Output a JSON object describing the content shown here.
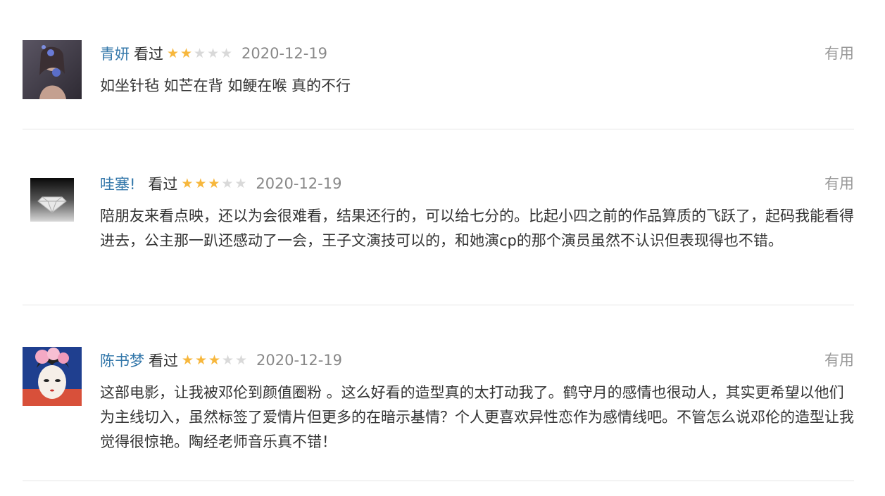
{
  "comments": [
    {
      "user": "青妍",
      "status": "看过",
      "rating": 2,
      "date": "2020-12-19",
      "useful": "有用",
      "text": "如坐针毡 如芒在背 如鲠在喉 真的不行"
    },
    {
      "user": "哇塞!",
      "status": "看过",
      "rating": 3,
      "date": "2020-12-19",
      "useful": "有用",
      "text": "陪朋友来看点映，还以为会很难看，结果还行的，可以给七分的。比起小四之前的作品算质的飞跃了，起码我能看得进去，公主那一趴还感动了一会，王子文演技可以的，和她演cp的那个演员虽然不认识但表现得也不错。"
    },
    {
      "user": "陈书梦",
      "status": "看过",
      "rating": 3,
      "date": "2020-12-19",
      "useful": "有用",
      "text": "这部电影，让我被邓伦到颜值圈粉 。这么好看的造型真的太打动我了。鹤守月的感情也很动人，其实更希望以他们为主线切入，虽然标签了爱情片但更多的在暗示基情？个人更喜欢异性恋作为感情线吧。不管怎么说邓伦的造型让我觉得很惊艳。陶经老师音乐真不错！"
    }
  ],
  "colors": {
    "username": "#3377aa",
    "star_on": "#f7b73c",
    "star_off": "#d9d9d9",
    "date": "#888888",
    "useful": "#999999",
    "divider": "#e6e6e6"
  },
  "rating_max": 5
}
